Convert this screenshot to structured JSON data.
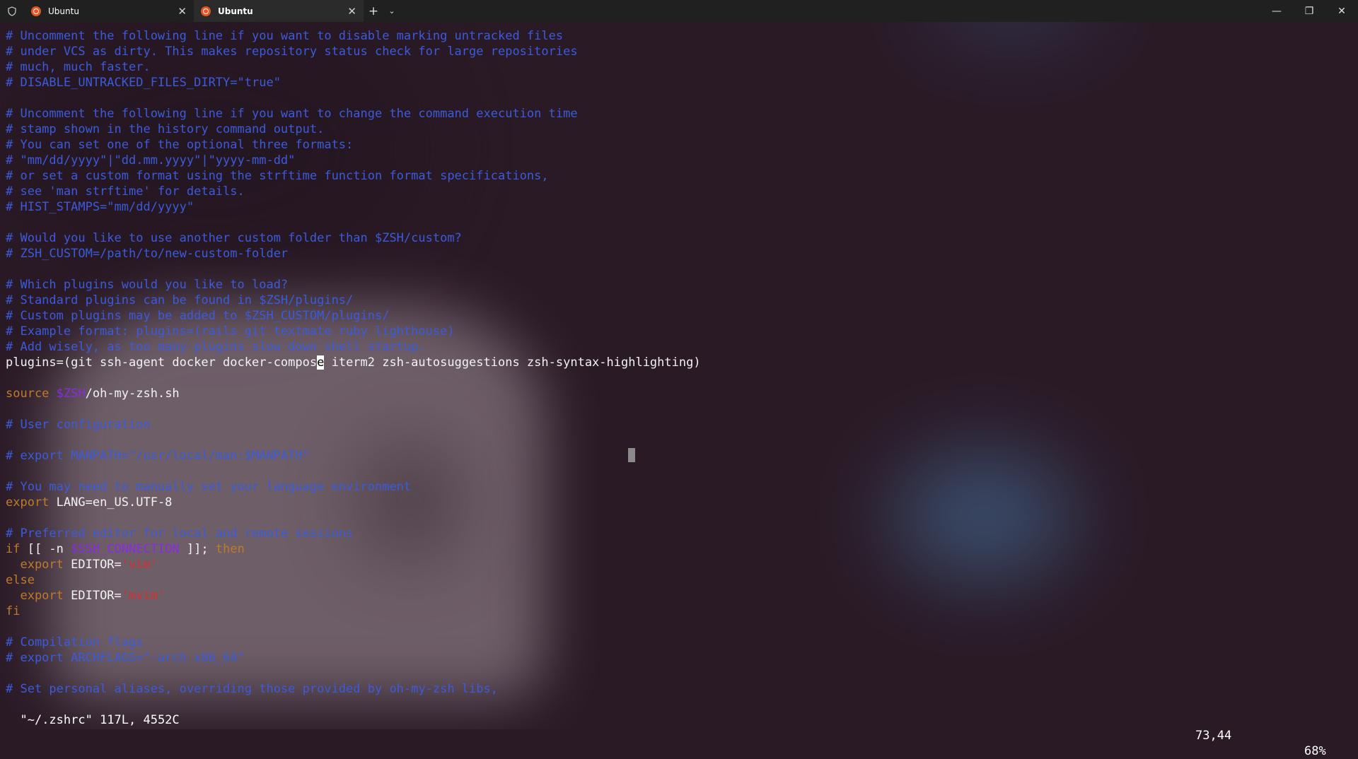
{
  "tabs": [
    {
      "title": "Ubuntu",
      "active": false
    },
    {
      "title": "Ubuntu",
      "active": true
    }
  ],
  "tab_close_glyph": "✕",
  "new_tab_glyph": "+",
  "dropdown_glyph": "⌄",
  "window_controls": {
    "minimize": "—",
    "maximize": "❐",
    "close": "✕"
  },
  "colors": {
    "comment": "#3b5bdb",
    "keyword": "#c07a2a",
    "variable": "#8a2be2",
    "string": "#d62f2f",
    "text": "#f2f2f2"
  },
  "editor": {
    "lines": [
      {
        "segments": [
          {
            "t": "# Uncomment the following line if you want to disable marking untracked files",
            "c": "comment"
          }
        ]
      },
      {
        "segments": [
          {
            "t": "# under VCS as dirty. This makes repository status check for large repositories",
            "c": "comment"
          }
        ]
      },
      {
        "segments": [
          {
            "t": "# much, much faster.",
            "c": "comment"
          }
        ]
      },
      {
        "segments": [
          {
            "t": "# DISABLE_UNTRACKED_FILES_DIRTY=\"true\"",
            "c": "comment"
          }
        ]
      },
      {
        "segments": []
      },
      {
        "segments": [
          {
            "t": "# Uncomment the following line if you want to change the command execution time",
            "c": "comment"
          }
        ]
      },
      {
        "segments": [
          {
            "t": "# stamp shown in the history command output.",
            "c": "comment"
          }
        ]
      },
      {
        "segments": [
          {
            "t": "# You can set one of the optional three formats:",
            "c": "comment"
          }
        ]
      },
      {
        "segments": [
          {
            "t": "# \"mm/dd/yyyy\"|\"dd.mm.yyyy\"|\"yyyy-mm-dd\"",
            "c": "comment"
          }
        ]
      },
      {
        "segments": [
          {
            "t": "# or set a custom format using the strftime function format specifications,",
            "c": "comment"
          }
        ]
      },
      {
        "segments": [
          {
            "t": "# see 'man strftime' for details.",
            "c": "comment"
          }
        ]
      },
      {
        "segments": [
          {
            "t": "# HIST_STAMPS=\"mm/dd/yyyy\"",
            "c": "comment"
          }
        ]
      },
      {
        "segments": []
      },
      {
        "segments": [
          {
            "t": "# Would you like to use another custom folder than $ZSH/custom?",
            "c": "comment"
          }
        ]
      },
      {
        "segments": [
          {
            "t": "# ZSH_CUSTOM=/path/to/new-custom-folder",
            "c": "comment"
          }
        ]
      },
      {
        "segments": []
      },
      {
        "segments": [
          {
            "t": "# Which plugins would you like to load?",
            "c": "comment"
          }
        ]
      },
      {
        "segments": [
          {
            "t": "# Standard plugins can be found in $ZSH/plugins/",
            "c": "comment"
          }
        ]
      },
      {
        "segments": [
          {
            "t": "# Custom plugins may be added to $ZSH_CUSTOM/plugins/",
            "c": "comment"
          }
        ]
      },
      {
        "segments": [
          {
            "t": "# Example format: plugins=(rails git textmate ruby lighthouse)",
            "c": "comment"
          }
        ]
      },
      {
        "segments": [
          {
            "t": "# Add wisely, as too many plugins slow down shell startup.",
            "c": "comment"
          }
        ]
      },
      {
        "segments": [
          {
            "t": "plugins=(git ssh-agent docker docker-compos",
            "c": "text"
          },
          {
            "t": "e",
            "c": "cursor"
          },
          {
            "t": " iterm2 zsh-autosuggestions zsh-syntax-highlighting)",
            "c": "text"
          }
        ]
      },
      {
        "segments": []
      },
      {
        "segments": [
          {
            "t": "source ",
            "c": "keyword"
          },
          {
            "t": "$ZSH",
            "c": "variable"
          },
          {
            "t": "/oh-my-zsh.sh",
            "c": "text"
          }
        ]
      },
      {
        "segments": []
      },
      {
        "segments": [
          {
            "t": "# User configuration",
            "c": "comment"
          }
        ]
      },
      {
        "segments": []
      },
      {
        "segments": [
          {
            "t": "# export MANPATH=\"/usr/local/man:$MANPATH\"",
            "c": "comment"
          }
        ]
      },
      {
        "segments": []
      },
      {
        "segments": [
          {
            "t": "# You may need to manually set your language environment",
            "c": "comment"
          }
        ]
      },
      {
        "segments": [
          {
            "t": "export ",
            "c": "keyword"
          },
          {
            "t": "LANG=en_US.UTF-8",
            "c": "text"
          }
        ]
      },
      {
        "segments": []
      },
      {
        "segments": [
          {
            "t": "# Preferred editor for local and remote sessions",
            "c": "comment"
          }
        ]
      },
      {
        "segments": [
          {
            "t": "if ",
            "c": "keyword"
          },
          {
            "t": "[[ -n ",
            "c": "text"
          },
          {
            "t": "$SSH_CONNECTION",
            "c": "variable"
          },
          {
            "t": " ]]; ",
            "c": "text"
          },
          {
            "t": "then",
            "c": "keyword"
          }
        ]
      },
      {
        "segments": [
          {
            "t": "  export ",
            "c": "keyword"
          },
          {
            "t": "EDITOR=",
            "c": "text"
          },
          {
            "t": "'vim'",
            "c": "string"
          }
        ]
      },
      {
        "segments": [
          {
            "t": "else",
            "c": "keyword"
          }
        ]
      },
      {
        "segments": [
          {
            "t": "  export ",
            "c": "keyword"
          },
          {
            "t": "EDITOR=",
            "c": "text"
          },
          {
            "t": "'mvim'",
            "c": "string"
          }
        ]
      },
      {
        "segments": [
          {
            "t": "fi",
            "c": "keyword"
          }
        ]
      },
      {
        "segments": []
      },
      {
        "segments": [
          {
            "t": "# Compilation flags",
            "c": "comment"
          }
        ]
      },
      {
        "segments": [
          {
            "t": "# export ARCHFLAGS=\"-arch x86_64\"",
            "c": "comment"
          }
        ]
      },
      {
        "segments": []
      },
      {
        "segments": [
          {
            "t": "# Set personal aliases, overriding those provided by oh-my-zsh libs,",
            "c": "comment"
          }
        ]
      }
    ]
  },
  "status_bar": {
    "file_info": "\"~/.zshrc\" 117L, 4552C",
    "position": "73,44",
    "percent": "68%"
  }
}
